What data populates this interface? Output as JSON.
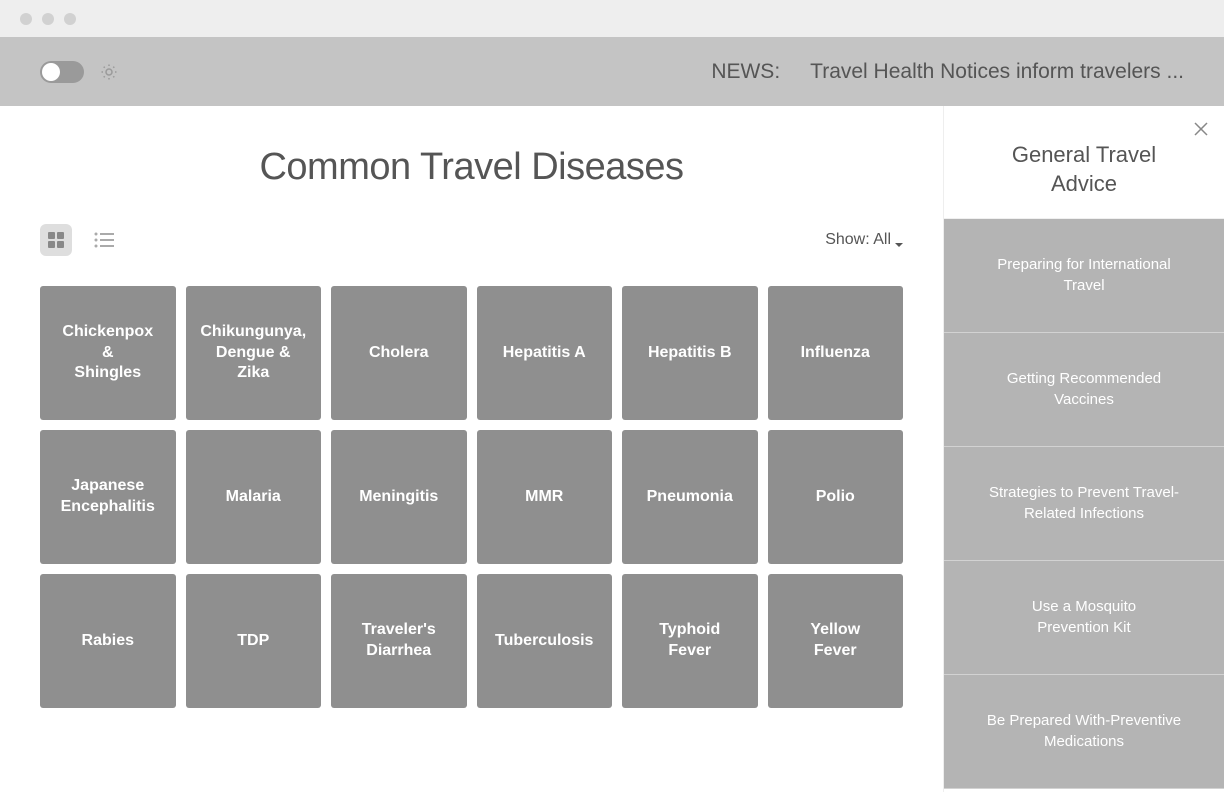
{
  "topbar": {
    "news_label": "NEWS:",
    "news_text": "Travel Health Notices inform travelers ..."
  },
  "main": {
    "title": "Common Travel Diseases",
    "filter_label": "Show: All"
  },
  "diseases": [
    {
      "label": "Chickenpox\n&\nShingles"
    },
    {
      "label": "Chikungunya,\nDengue &\nZika"
    },
    {
      "label": "Cholera"
    },
    {
      "label": "Hepatitis A"
    },
    {
      "label": "Hepatitis B"
    },
    {
      "label": "Influenza"
    },
    {
      "label": "Japanese\nEncephalitis"
    },
    {
      "label": "Malaria"
    },
    {
      "label": "Meningitis"
    },
    {
      "label": "MMR"
    },
    {
      "label": "Pneumonia"
    },
    {
      "label": "Polio"
    },
    {
      "label": "Rabies"
    },
    {
      "label": "TDP"
    },
    {
      "label": "Traveler's\nDiarrhea"
    },
    {
      "label": "Tuberculosis"
    },
    {
      "label": "Typhoid\nFever"
    },
    {
      "label": "Yellow\nFever"
    }
  ],
  "sidebar": {
    "title": "General Travel\nAdvice",
    "items": [
      {
        "label": "Preparing for International\nTravel"
      },
      {
        "label": "Getting Recommended\nVaccines"
      },
      {
        "label": "Strategies to Prevent Travel-\nRelated Infections"
      },
      {
        "label": "Use a Mosquito\nPrevention Kit"
      },
      {
        "label": "Be Prepared With-Preventive\nMedications"
      }
    ]
  }
}
